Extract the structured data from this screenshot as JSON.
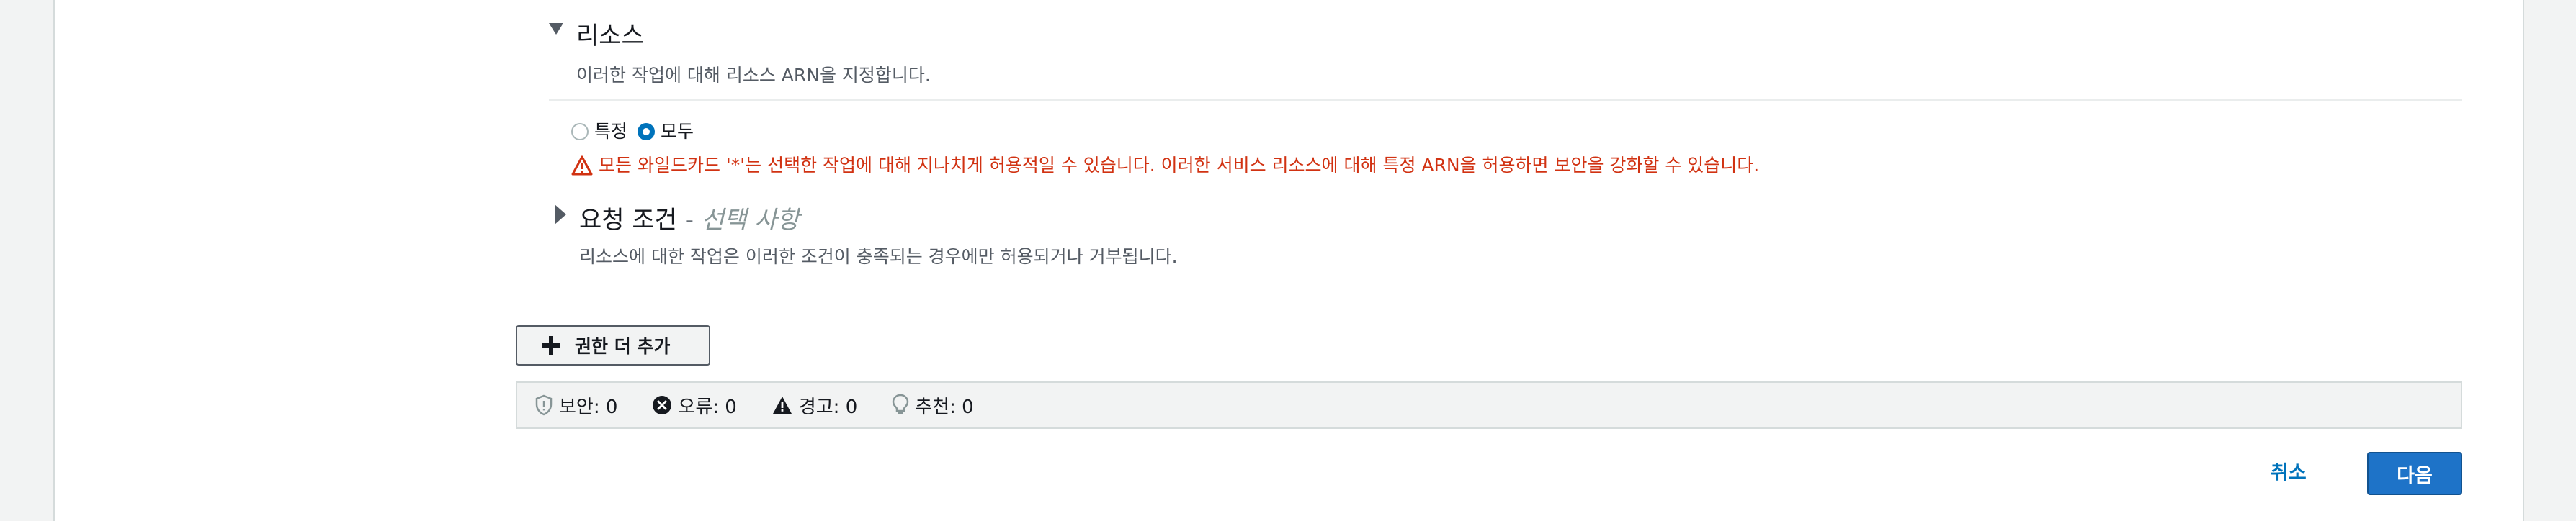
{
  "resources": {
    "title": "리소스",
    "description": "이러한 작업에 대해 리소스 ARN을 지정합니다.",
    "radio_specific": "특정",
    "radio_all": "모두",
    "selected": "모두",
    "warning": "모든 와일드카드 '*'는 선택한 작업에 대해 지나치게 허용적일 수 있습니다. 이러한 서비스 리소스에 대해 특정 ARN을 허용하면 보안을 강화할 수 있습니다."
  },
  "conditions": {
    "title": "요청 조건",
    "dash": " - ",
    "optional": "선택 사항",
    "description": "리소스에 대한 작업은 이러한 조건이 충족되는 경우에만 허용되거나 거부됩니다."
  },
  "add_button": {
    "label": "권한 더 추가"
  },
  "status": {
    "security": "보안: 0",
    "errors": "오류: 0",
    "warnings": "경고: 0",
    "suggestions": "추천: 0"
  },
  "footer": {
    "cancel": "취소",
    "next": "다음"
  },
  "colors": {
    "primary": "#1e73c8",
    "link": "#0073bb",
    "warning": "#d13212"
  }
}
